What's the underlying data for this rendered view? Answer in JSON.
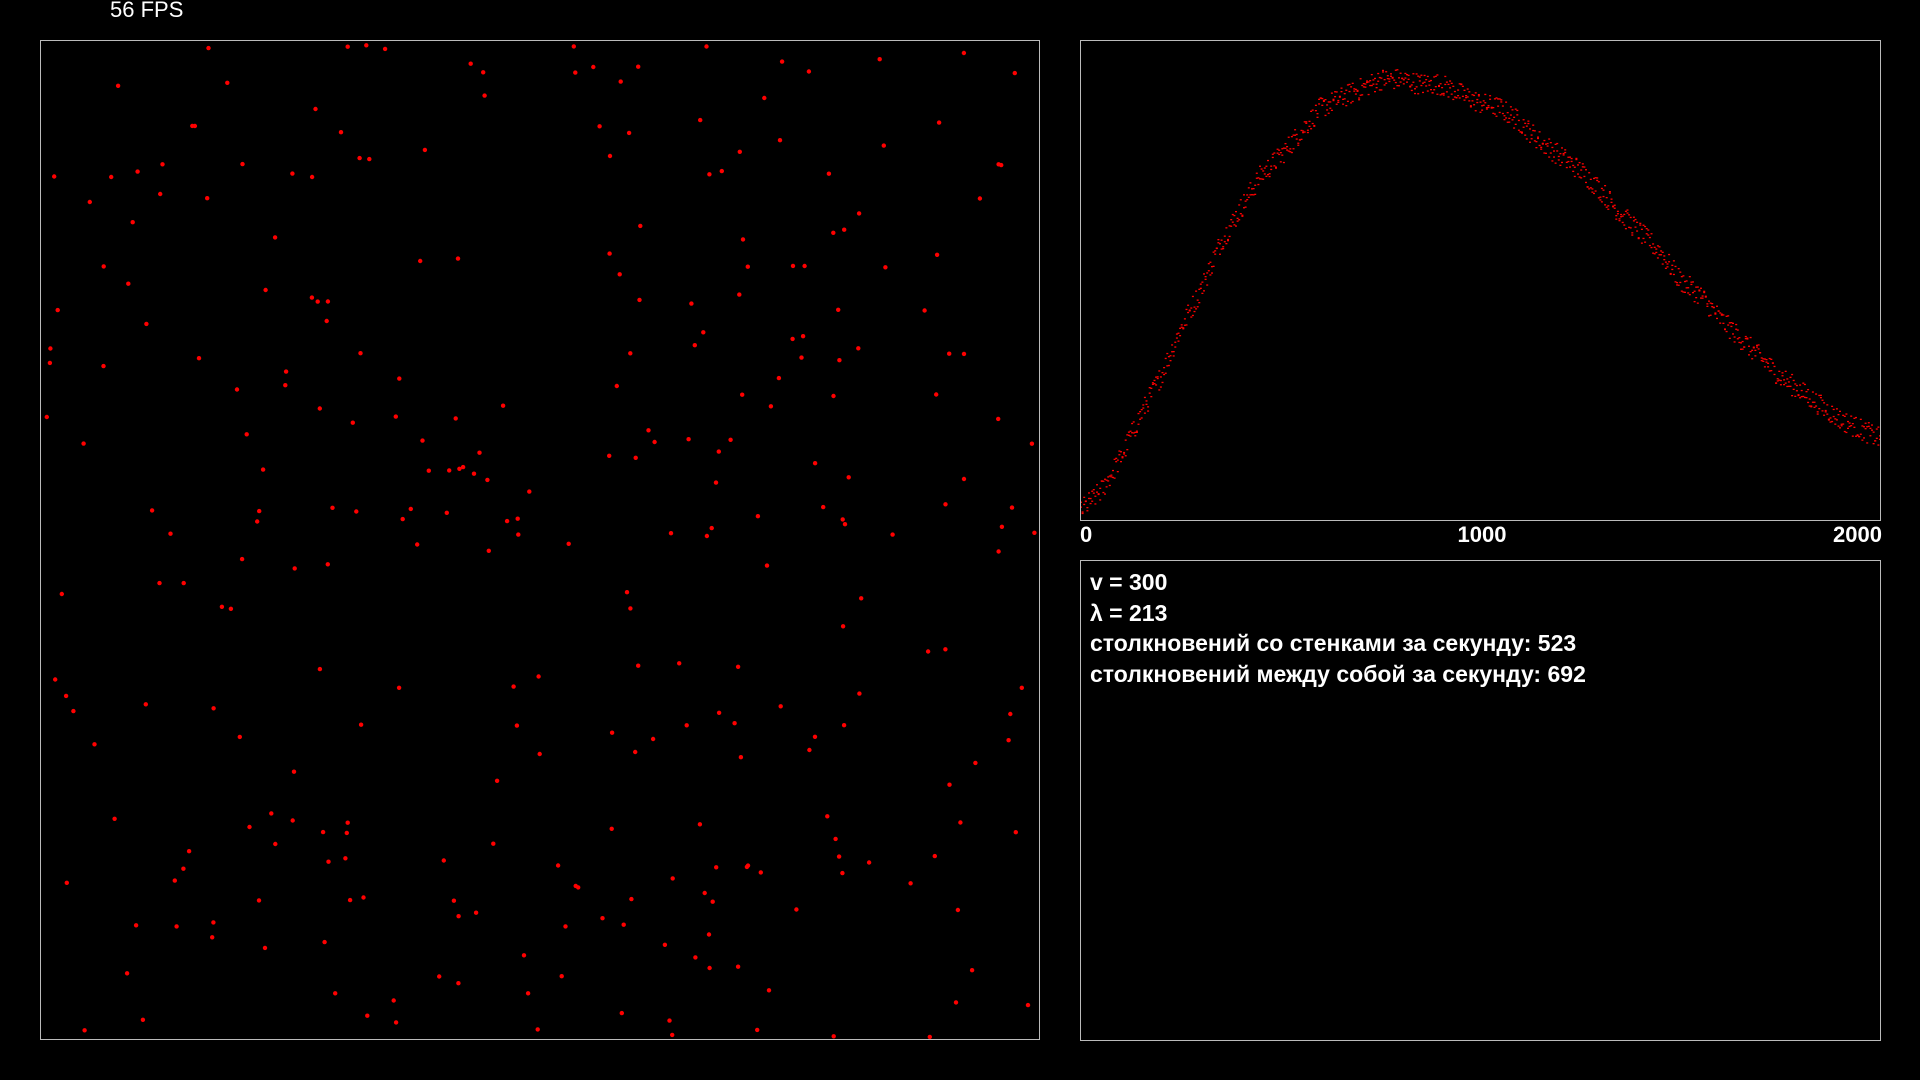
{
  "fps_label": "56 FPS",
  "colors": {
    "background": "#000000",
    "particle": "#ff0000",
    "border": "#bbbbbb",
    "text": "#ffffff"
  },
  "simulation": {
    "particle_count": 300
  },
  "info": {
    "v": "v = 300",
    "lambda": "λ = 213",
    "wall_collisions": "столкновений со стенками за секунду: 523",
    "mutual_collisions": "столкновений между собой за секунду: 692"
  },
  "chart_data": {
    "type": "scatter",
    "title": "",
    "xlabel": "",
    "ylabel": "",
    "x_ticks": [
      "0",
      "1000",
      "2000"
    ],
    "xlim": [
      0,
      2000
    ],
    "ylim": [
      0,
      1
    ],
    "grid": false,
    "series": [
      {
        "color": "#ff0000",
        "points": [
          [
            0,
            0.02
          ],
          [
            50,
            0.06
          ],
          [
            100,
            0.13
          ],
          [
            150,
            0.22
          ],
          [
            200,
            0.3
          ],
          [
            250,
            0.4
          ],
          [
            300,
            0.48
          ],
          [
            350,
            0.58
          ],
          [
            400,
            0.65
          ],
          [
            450,
            0.72
          ],
          [
            500,
            0.76
          ],
          [
            550,
            0.81
          ],
          [
            600,
            0.86
          ],
          [
            650,
            0.88
          ],
          [
            700,
            0.9
          ],
          [
            750,
            0.92
          ],
          [
            800,
            0.92
          ],
          [
            850,
            0.91
          ],
          [
            900,
            0.91
          ],
          [
            950,
            0.89
          ],
          [
            1000,
            0.87
          ],
          [
            1050,
            0.86
          ],
          [
            1100,
            0.83
          ],
          [
            1150,
            0.79
          ],
          [
            1200,
            0.76
          ],
          [
            1250,
            0.73
          ],
          [
            1300,
            0.69
          ],
          [
            1350,
            0.64
          ],
          [
            1400,
            0.6
          ],
          [
            1450,
            0.56
          ],
          [
            1500,
            0.5
          ],
          [
            1550,
            0.47
          ],
          [
            1600,
            0.42
          ],
          [
            1650,
            0.38
          ],
          [
            1700,
            0.34
          ],
          [
            1750,
            0.3
          ],
          [
            1800,
            0.27
          ],
          [
            1850,
            0.24
          ],
          [
            1900,
            0.21
          ],
          [
            1950,
            0.19
          ],
          [
            2000,
            0.17
          ]
        ]
      }
    ]
  }
}
